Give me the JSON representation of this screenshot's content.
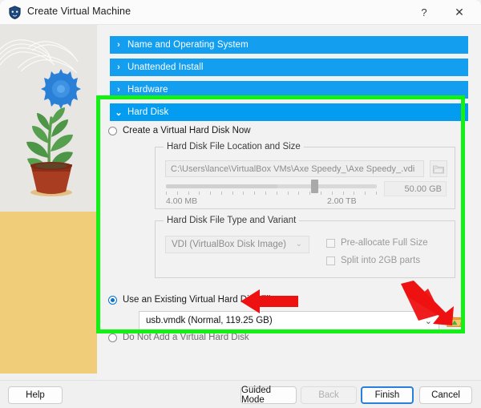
{
  "window": {
    "title": "Create Virtual Machine",
    "logo_icon": "virtualbox-shield-icon",
    "help_icon": "?",
    "close_icon": "✕"
  },
  "sections": [
    {
      "id": "name-and-operating-system",
      "label": "Name and Operating System",
      "chevron": "›",
      "expanded": false
    },
    {
      "id": "unattended-install",
      "label": "Unattended Install",
      "chevron": "›",
      "expanded": false
    },
    {
      "id": "hardware",
      "label": "Hardware",
      "chevron": "›",
      "expanded": false
    },
    {
      "id": "hard-disk",
      "label": "Hard Disk",
      "chevron": "⌄",
      "expanded": true
    }
  ],
  "hard_disk": {
    "option_create": {
      "label": "Create a Virtual Hard Disk Now",
      "selected": false
    },
    "location_group": {
      "title": "Hard Disk File Location and Size",
      "path_value": "C:\\Users\\lance\\VirtualBox VMs\\Axe Speedy_\\Axe Speedy_.vdi",
      "browse_icon": "folder-icon",
      "size_value": "50.00 GB",
      "range_min": "4.00 MB",
      "range_max": "2.00 TB",
      "slider_percent": 52
    },
    "type_group": {
      "title": "Hard Disk File Type and Variant",
      "format_value": "VDI (VirtualBox Disk Image)",
      "format_chevron": "⌄",
      "checkbox_prealloc": "Pre-allocate Full Size",
      "checkbox_split": "Split into 2GB parts",
      "prealloc_checked": false,
      "split_checked": false
    },
    "option_existing": {
      "label": "Use an Existing Virtual Hard Disk File",
      "selected": true,
      "combo_value": "usb.vmdk (Normal, 119.25 GB)",
      "combo_chevron": "⌄",
      "browse_icon": "folder-open-icon"
    },
    "option_none": {
      "label": "Do Not Add a Virtual Hard Disk",
      "selected": false
    }
  },
  "footer": {
    "help": "Help",
    "guided_mode": "Guided Mode",
    "back": "Back",
    "finish": "Finish",
    "cancel": "Cancel"
  },
  "annotations": {
    "highlight_color": "#13f013",
    "arrow_color": "#ee1111",
    "arrow_left_name": "red-arrow-pointing-to-use-existing-option",
    "arrow_diagonal_name": "red-arrow-pointing-to-disk-dropdown"
  },
  "theme": {
    "section_blue": "#139ef0",
    "accent_blue": "#0a72d0",
    "sidebar_bg": "#e8e6e2",
    "sidebar_ground": "#f0cd78"
  }
}
